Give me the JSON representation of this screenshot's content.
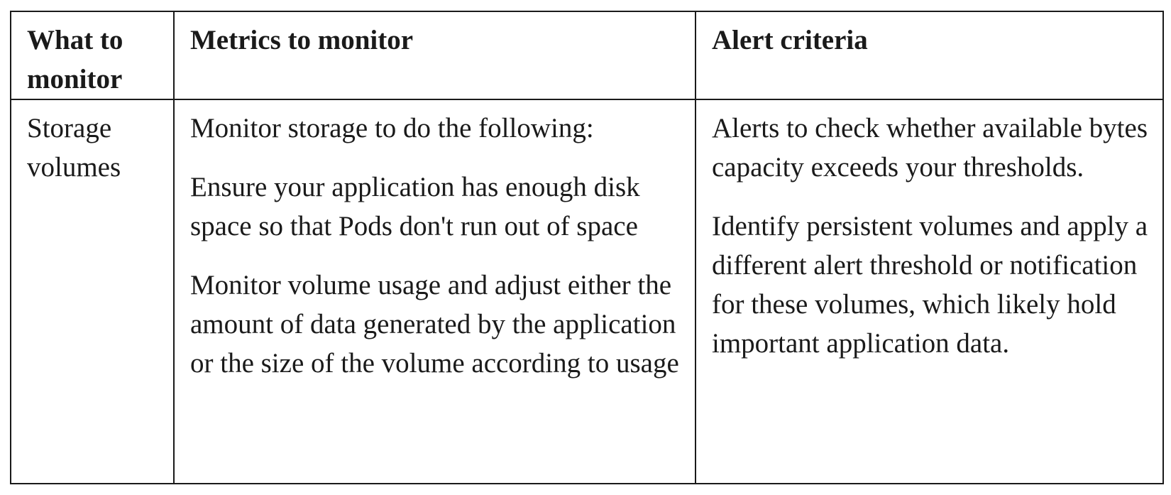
{
  "table": {
    "headers": [
      "What to monitor",
      "Metrics to monitor",
      "Alert criteria"
    ],
    "rows": [
      {
        "what": "Storage volumes",
        "metrics": [
          "Monitor storage to do the following:",
          "Ensure your application has enough disk space so that Pods don't run out of space",
          "Monitor volume usage and adjust either the amount of data generated by the application or the size of the volume according to usage"
        ],
        "alerts": [
          "Alerts to check whether available bytes capacity exceeds your thresholds.",
          "Identify persistent volumes and apply a different alert threshold or notification for these volumes, which likely hold important application data."
        ]
      }
    ]
  }
}
